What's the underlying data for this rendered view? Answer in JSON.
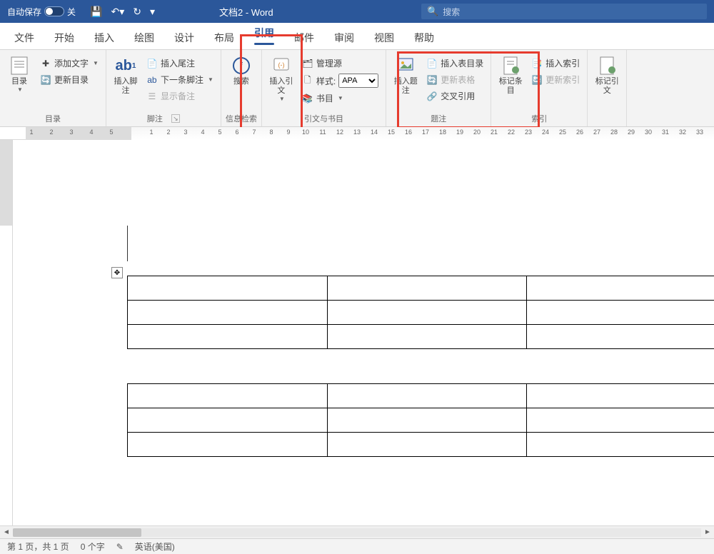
{
  "title_bar": {
    "autosave_label": "自动保存",
    "autosave_state": "关",
    "doc_title": "文档2 - Word",
    "search_placeholder": "搜索"
  },
  "tabs": {
    "file": "文件",
    "home": "开始",
    "insert": "插入",
    "draw": "绘图",
    "design": "设计",
    "layout": "布局",
    "references": "引用",
    "mailings": "邮件",
    "review": "审阅",
    "view": "视图",
    "help": "帮助"
  },
  "ribbon": {
    "toc": {
      "toc_btn": "目录",
      "add_text": "添加文字",
      "update_toc": "更新目录",
      "group_label": "目录"
    },
    "footnotes": {
      "insert_footnote": "插入脚注",
      "insert_endnote": "插入尾注",
      "next_footnote": "下一条脚注",
      "show_notes": "显示备注",
      "group_label": "脚注",
      "ab_label": "ab"
    },
    "research": {
      "search_btn": "搜索",
      "group_label": "信息检索"
    },
    "citations": {
      "insert_citation": "插入引文",
      "manage_sources": "管理源",
      "style_label": "样式:",
      "style_value": "APA",
      "bibliography": "书目",
      "group_label": "引文与书目"
    },
    "captions": {
      "insert_caption": "插入题注",
      "insert_tof": "插入表目录",
      "update_table": "更新表格",
      "cross_ref": "交叉引用",
      "group_label": "题注"
    },
    "index": {
      "mark_entry": "标记条目",
      "insert_index": "插入索引",
      "update_index": "更新索引",
      "group_label": "索引"
    },
    "toa": {
      "mark_citation": "标记引文"
    }
  },
  "ruler": {
    "neg": [
      "5",
      "4",
      "3",
      "2",
      "1"
    ],
    "pos": [
      "1",
      "2",
      "3",
      "4",
      "5",
      "6",
      "7",
      "8",
      "9",
      "10",
      "11",
      "12",
      "13",
      "14",
      "15",
      "16",
      "17",
      "18",
      "19",
      "20",
      "21",
      "22",
      "23",
      "24",
      "25",
      "26",
      "27",
      "28",
      "29",
      "30",
      "31",
      "32",
      "33"
    ]
  },
  "status": {
    "page": "第 1 页，共 1 页",
    "words": "0 个字",
    "lang": "英语(美国)"
  }
}
